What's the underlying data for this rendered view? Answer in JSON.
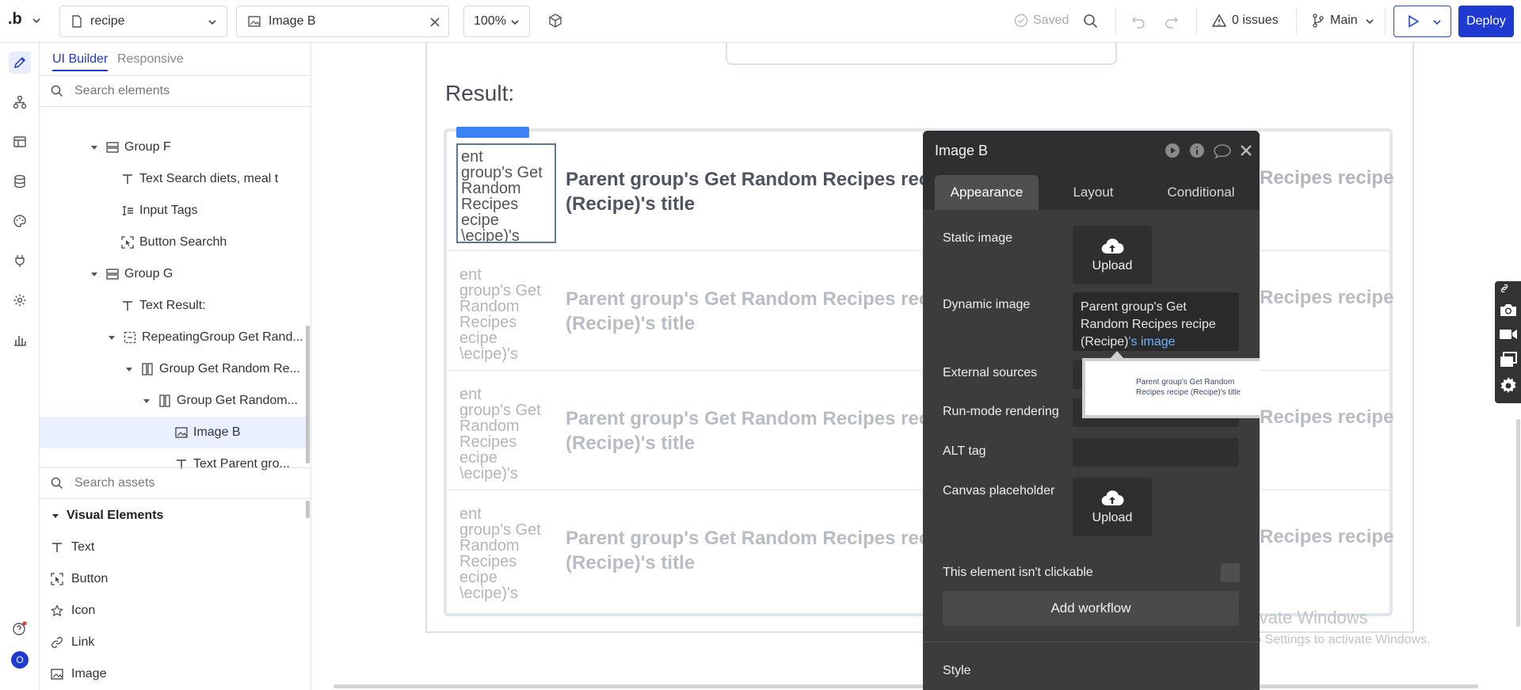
{
  "topbar": {
    "logo": ".b",
    "page_name": "recipe",
    "element_name": "Image B",
    "zoom": "100%",
    "saved_label": "Saved",
    "issues_label": "0 issues",
    "branch_label": "Main",
    "deploy_label": "Deploy"
  },
  "panel": {
    "tab_ui_builder": "UI Builder",
    "tab_responsive": "Responsive",
    "search_elements_placeholder": "Search elements",
    "tree": [
      {
        "label": "Group F",
        "icon": "group-icon"
      },
      {
        "label": "Text Search diets, meal t",
        "icon": "text-icon"
      },
      {
        "label": "Input Tags",
        "icon": "input-icon"
      },
      {
        "label": "Button Searchh",
        "icon": "button-icon"
      },
      {
        "label": "Group G",
        "icon": "group-icon"
      },
      {
        "label": "Text Result:",
        "icon": "text-icon"
      },
      {
        "label": "RepeatingGroup Get Rand...",
        "icon": "repeating-group-icon"
      },
      {
        "label": "Group Get Random Re...",
        "icon": "column-group-icon"
      },
      {
        "label": "Group Get Random...",
        "icon": "column-group-icon"
      },
      {
        "label": "Image B",
        "icon": "image-icon"
      },
      {
        "label": "Text Parent gro...",
        "icon": "text-icon"
      }
    ],
    "search_assets_placeholder": "Search assets",
    "visual_elements_heading": "Visual Elements",
    "assets": [
      {
        "label": "Text",
        "icon": "text-icon"
      },
      {
        "label": "Button",
        "icon": "button-icon"
      },
      {
        "label": "Icon",
        "icon": "star-icon"
      },
      {
        "label": "Link",
        "icon": "link-icon"
      },
      {
        "label": "Image",
        "icon": "image-icon"
      }
    ],
    "user_avatar_letter": "O"
  },
  "canvas": {
    "result_label": "Result:",
    "image_placeholder_text": "ent\ngroup's Get\nRandom\nRecipes\necipe\n\\ecipe)'s",
    "row_title": "Parent group's Get Random Recipes recipe (Recipe)'s title",
    "row_title_right": "Recipes recipe",
    "rows": 4,
    "watermark_title": "Activate Windows",
    "watermark_sub": "Go to Settings to activate Windows."
  },
  "property_editor": {
    "title": "Image B",
    "tabs": [
      "Appearance",
      "Layout",
      "Conditional"
    ],
    "active_tab": "Appearance",
    "static_image_label": "Static image",
    "upload_label": "Upload",
    "dynamic_image_label": "Dynamic image",
    "dynamic_image_value": "Parent group's Get Random Recipes recipe (Recipe)",
    "dynamic_image_suffix": "'s image",
    "external_sources_label": "External sources",
    "run_mode_label": "Run-mode rendering",
    "alt_tag_label": "ALT tag",
    "canvas_placeholder_label": "Canvas placeholder",
    "not_clickable_label": "This element isn't clickable",
    "add_workflow_label": "Add workflow",
    "style_label": "Style",
    "tooltip_text": "Parent group's Get Random Recipes recipe (Recipe)'s title"
  },
  "colors": {
    "accent": "#1f3ad1",
    "editor_bg": "#3c3c3c",
    "editor_header": "#2f2f2f",
    "link_highlight": "#6fb0ff"
  }
}
